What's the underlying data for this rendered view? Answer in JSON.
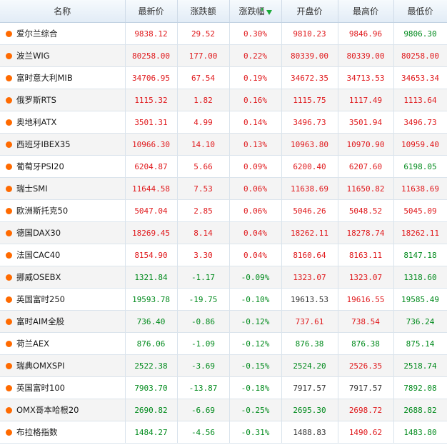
{
  "colors": {
    "up": "#e0191c",
    "down": "#008a1c",
    "flat": "#333333",
    "dot": "#ff6a00",
    "header_bg": "#e2ecf6",
    "alt_row": "#f4f4f4"
  },
  "header": {
    "name": "名称",
    "last": "最新价",
    "change": "涨跌额",
    "change_pct": "涨跌幅",
    "open": "开盘价",
    "high": "最高价",
    "low": "最低价",
    "sort_icon": "sort-down-arrow-icon"
  },
  "rows": [
    {
      "name": "爱尔兰综合",
      "last": "9838.12",
      "change": "29.52",
      "pct": "0.30%",
      "open": "9810.23",
      "high": "9846.96",
      "low": "9806.30",
      "dir": "up"
    },
    {
      "name": "波兰WIG",
      "last": "80258.00",
      "change": "177.00",
      "pct": "0.22%",
      "open": "80339.00",
      "high": "80339.00",
      "low": "80258.00",
      "dir": "up"
    },
    {
      "name": "富时意大利MIB",
      "last": "34706.95",
      "change": "67.54",
      "pct": "0.19%",
      "open": "34672.35",
      "high": "34713.53",
      "low": "34653.34",
      "dir": "up"
    },
    {
      "name": "俄罗斯RTS",
      "last": "1115.32",
      "change": "1.82",
      "pct": "0.16%",
      "open": "1115.75",
      "high": "1117.49",
      "low": "1113.64",
      "dir": "up"
    },
    {
      "name": "奥地利ATX",
      "last": "3501.31",
      "change": "4.99",
      "pct": "0.14%",
      "open": "3496.73",
      "high": "3501.94",
      "low": "3496.73",
      "dir": "up"
    },
    {
      "name": "西班牙IBEX35",
      "last": "10966.30",
      "change": "14.10",
      "pct": "0.13%",
      "open": "10963.80",
      "high": "10970.90",
      "low": "10959.40",
      "dir": "up"
    },
    {
      "name": "葡萄牙PSI20",
      "last": "6204.87",
      "change": "5.66",
      "pct": "0.09%",
      "open": "6200.40",
      "high": "6207.60",
      "low": "6198.05",
      "dir": "up"
    },
    {
      "name": "瑞士SMI",
      "last": "11644.58",
      "change": "7.53",
      "pct": "0.06%",
      "open": "11638.69",
      "high": "11650.82",
      "low": "11638.69",
      "dir": "up"
    },
    {
      "name": "欧洲斯托克50",
      "last": "5047.04",
      "change": "2.85",
      "pct": "0.06%",
      "open": "5046.26",
      "high": "5048.52",
      "low": "5045.09",
      "dir": "up"
    },
    {
      "name": "德国DAX30",
      "last": "18269.45",
      "change": "8.14",
      "pct": "0.04%",
      "open": "18262.11",
      "high": "18278.74",
      "low": "18262.11",
      "dir": "up"
    },
    {
      "name": "法国CAC40",
      "last": "8154.90",
      "change": "3.30",
      "pct": "0.04%",
      "open": "8160.64",
      "high": "8163.11",
      "low": "8147.18",
      "dir": "up"
    },
    {
      "name": "挪威OSEBX",
      "last": "1321.84",
      "change": "-1.17",
      "pct": "-0.09%",
      "open": "1323.07",
      "high": "1323.07",
      "low": "1318.60",
      "dir": "down"
    },
    {
      "name": "英国富时250",
      "last": "19593.78",
      "change": "-19.75",
      "pct": "-0.10%",
      "open": "19613.53",
      "high": "19616.55",
      "low": "19585.49",
      "dir": "down"
    },
    {
      "name": "富时AIM全股",
      "last": "736.40",
      "change": "-0.86",
      "pct": "-0.12%",
      "open": "737.61",
      "high": "738.54",
      "low": "736.24",
      "dir": "down"
    },
    {
      "name": "荷兰AEX",
      "last": "876.06",
      "change": "-1.09",
      "pct": "-0.12%",
      "open": "876.38",
      "high": "876.38",
      "low": "875.14",
      "dir": "down"
    },
    {
      "name": "瑞典OMXSPI",
      "last": "2522.38",
      "change": "-3.69",
      "pct": "-0.15%",
      "open": "2524.20",
      "high": "2526.35",
      "low": "2518.74",
      "dir": "down"
    },
    {
      "name": "英国富时100",
      "last": "7903.70",
      "change": "-13.87",
      "pct": "-0.18%",
      "open": "7917.57",
      "high": "7917.57",
      "low": "7892.08",
      "dir": "down"
    },
    {
      "name": "OMX哥本哈根20",
      "last": "2690.82",
      "change": "-6.69",
      "pct": "-0.25%",
      "open": "2695.30",
      "high": "2698.72",
      "low": "2688.82",
      "dir": "down"
    },
    {
      "name": "布拉格指数",
      "last": "1484.27",
      "change": "-4.56",
      "pct": "-0.31%",
      "open": "1488.83",
      "high": "1490.62",
      "low": "1483.80",
      "dir": "down"
    }
  ]
}
